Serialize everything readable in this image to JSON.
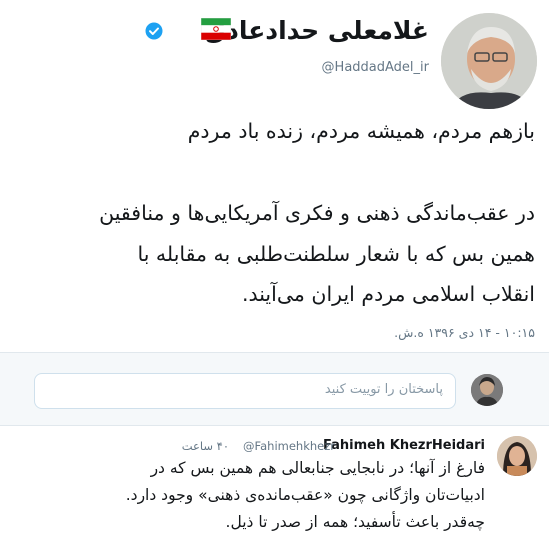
{
  "tweet": {
    "display_name": "غلامعلی حدادعادل",
    "handle": "@HaddadAdel_ir",
    "lines": [
      "بازهم مردم، همیشه مردم، زنده باد مردم",
      "در عقب‌ماندگی ذهنی و فکری آمریکایی‌ها و منافقین",
      "همین بس که با شعار سلطنت‌طلبی به مقابله با",
      "انقلاب اسلامی مردم ایران می‌آیند."
    ],
    "timestamp": "۱۰:۱۵ - ۱۴ دی ۱۳۹۶ ه.ش.",
    "flag_colors": [
      "#239f40",
      "#ffffff",
      "#da0000"
    ],
    "verified_color": "#1da1f2"
  },
  "reply_box": {
    "placeholder": "پاسختان را توییت کنید"
  },
  "reply": {
    "name": "Fahimeh KhezrHeidari",
    "handle": "@Fahimehkhezr",
    "time": "۴۰ ساعت",
    "lines": [
      "فارغ از آنها؛ در نابجایی جنابعالی هم همین بس که در",
      "ادبیات‌تان واژگانی چون «عقب‌مانده‌ی ذهنی» وجود دارد.",
      "چه‌قدر باعث تأسفید؛ همه از صدر تا ذیل."
    ]
  }
}
